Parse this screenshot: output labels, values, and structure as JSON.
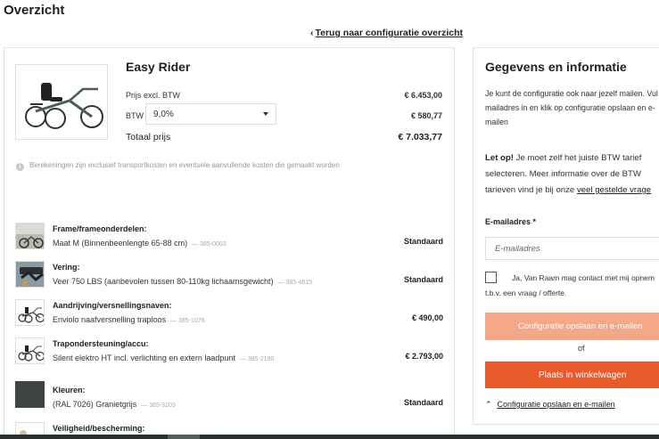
{
  "page": {
    "title": "Overzicht",
    "back_link": "Terug naar configuratie overzicht"
  },
  "product": {
    "name": "Easy Rider",
    "price_excl_label": "Prijs excl. BTW",
    "price_excl_value": "€ 6.453,00",
    "vat_label": "BTW",
    "vat_selected": "9,0%",
    "vat_value": "€ 580,77",
    "total_label": "Totaal prijs",
    "total_value": "€ 7.033,77",
    "note": "Berekeningen zijn exclusief transportkosten en eventuele aanvullende kosten die gemaakt worden"
  },
  "options": [
    {
      "title": "Frame/frameonderdelen:",
      "desc": "Maat M (Binnenbeenlengte 65-88 cm)",
      "code": "— 385-0003",
      "price": "Standaard"
    },
    {
      "title": "Vering:",
      "desc": "Veer 750 LBS (aanbevolen tussen 80-110kg lichaamsgewicht)",
      "code": "— 385-4615",
      "price": "Standaard"
    },
    {
      "title": "Aandrijving/versnellingsnaven:",
      "desc": "Enviolo naafversnelling traploos",
      "code": "— 385-1076",
      "price": "€ 490,00"
    },
    {
      "title": "Trapondersteuning/accu:",
      "desc": "Silent elektro HT incl. verlichting en extern laadpunt",
      "code": "— 385-2180",
      "price": "€ 2.793,00"
    },
    {
      "title": "Kleuren:",
      "desc": "(RAL 7026) Granietgrijs",
      "code": "— 385-3203",
      "price": "Standaard"
    },
    {
      "title": "Veiligheid/bescherming:",
      "desc": "",
      "code": "",
      "price": ""
    }
  ],
  "panel": {
    "title": "Gegevens en informatie",
    "intro_line1": "Je kunt de configuratie ook naar jezelf mailen. Vul",
    "intro_line2": "mailadres in en klik op configuratie opslaan en e-",
    "intro_line3": "mailen",
    "warning_bold": "Let op!",
    "warning_line1": " Je moet zelf het juiste BTW tarief",
    "warning_line2": "selecteren. Meer informatie over de BTW",
    "warning_line3": "tarieven vind je bij onze ",
    "warning_link": "veel gestelde vrage",
    "email_label": "E-mailadres *",
    "email_placeholder": "E-mailadres",
    "email_value": "",
    "consent_line1": "Ja, Van Raam mag contact met mij opnem",
    "consent_line2": "t.b.v. een vraag / offerte.",
    "save_button": "Configuratie opslaan en e-mailen",
    "or_text": "of",
    "cart_button": "Plaats in winkelwagen",
    "save_link": "Configuratie opslaan en e-mailen"
  },
  "colors": {
    "accent": "#e75b2b",
    "accent_light": "#f4a888",
    "frame_color": "#4c5a5c"
  }
}
